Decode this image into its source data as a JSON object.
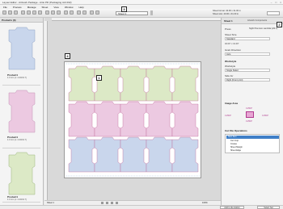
{
  "window": {
    "title": "Layout Editor - Artiwork Package - Artio PD (Packaging Job 002)",
    "controls": [
      "–",
      "□",
      "×"
    ]
  },
  "menu": [
    "File",
    "Process",
    "Manage",
    "Sheet",
    "View",
    "Window",
    "Help"
  ],
  "toolbar": {
    "sheet_select": "Sheet 1",
    "sheet_info": "Sheet format: 40.00 x 31.00 in",
    "sheet_info2": "Sheet size: 40.00 x 31.00 in"
  },
  "callouts": [
    "1",
    "2",
    "3",
    "4"
  ],
  "left_panel": {
    "title": "Products (3)",
    "products": [
      {
        "name": "Product1",
        "meta": "1.0 mm (L: 2.00/10.7)"
      },
      {
        "name": "Product1",
        "meta": "1.0 mm (L: 2.00/10.7)"
      },
      {
        "name": "Product1",
        "meta": "1.0 mm (L: 2.00/10.7)"
      }
    ]
  },
  "colors": {
    "green": "#dce9c6",
    "pink": "#ecc9e1",
    "blue": "#c9d6ec",
    "dieline": "#c26a9a"
  },
  "status": {
    "left": "Sheet 1",
    "right": "100%"
  },
  "right_panel": {
    "tab1": "Sheet 1",
    "tab2": "Artwork Components",
    "tab3": "1",
    "press_label": "Press",
    "press_value": "Sight Premium Lambda (HS 1)",
    "sheet_size_label": "Sheet Size",
    "sheet_size_value": "Standard",
    "dims": "40.00\" x  31.00\"",
    "grain_label": "Grain Direction",
    "grain_value": "Auto",
    "workstyle_head": "Workstyle",
    "workstyle_label": "Workstyle",
    "workstyle_value": "Single Sided",
    "side_label": "Side for",
    "side_value": "Right (Front print)",
    "image_area_head": "Image Area",
    "margin_top": "0.2500\"",
    "margin_left": "0.2500\"",
    "margin_right": "0.2500\"",
    "margin_bottom": "0.2500\"",
    "cut_file_head": "Cut File Operations",
    "cut_tree": [
      "New Item",
      "Cut Crop",
      "Crease",
      "Sheet Margin",
      "Sheet Edge"
    ],
    "footer_btn": "Add to die station",
    "footer_btn2": "Select Set"
  }
}
